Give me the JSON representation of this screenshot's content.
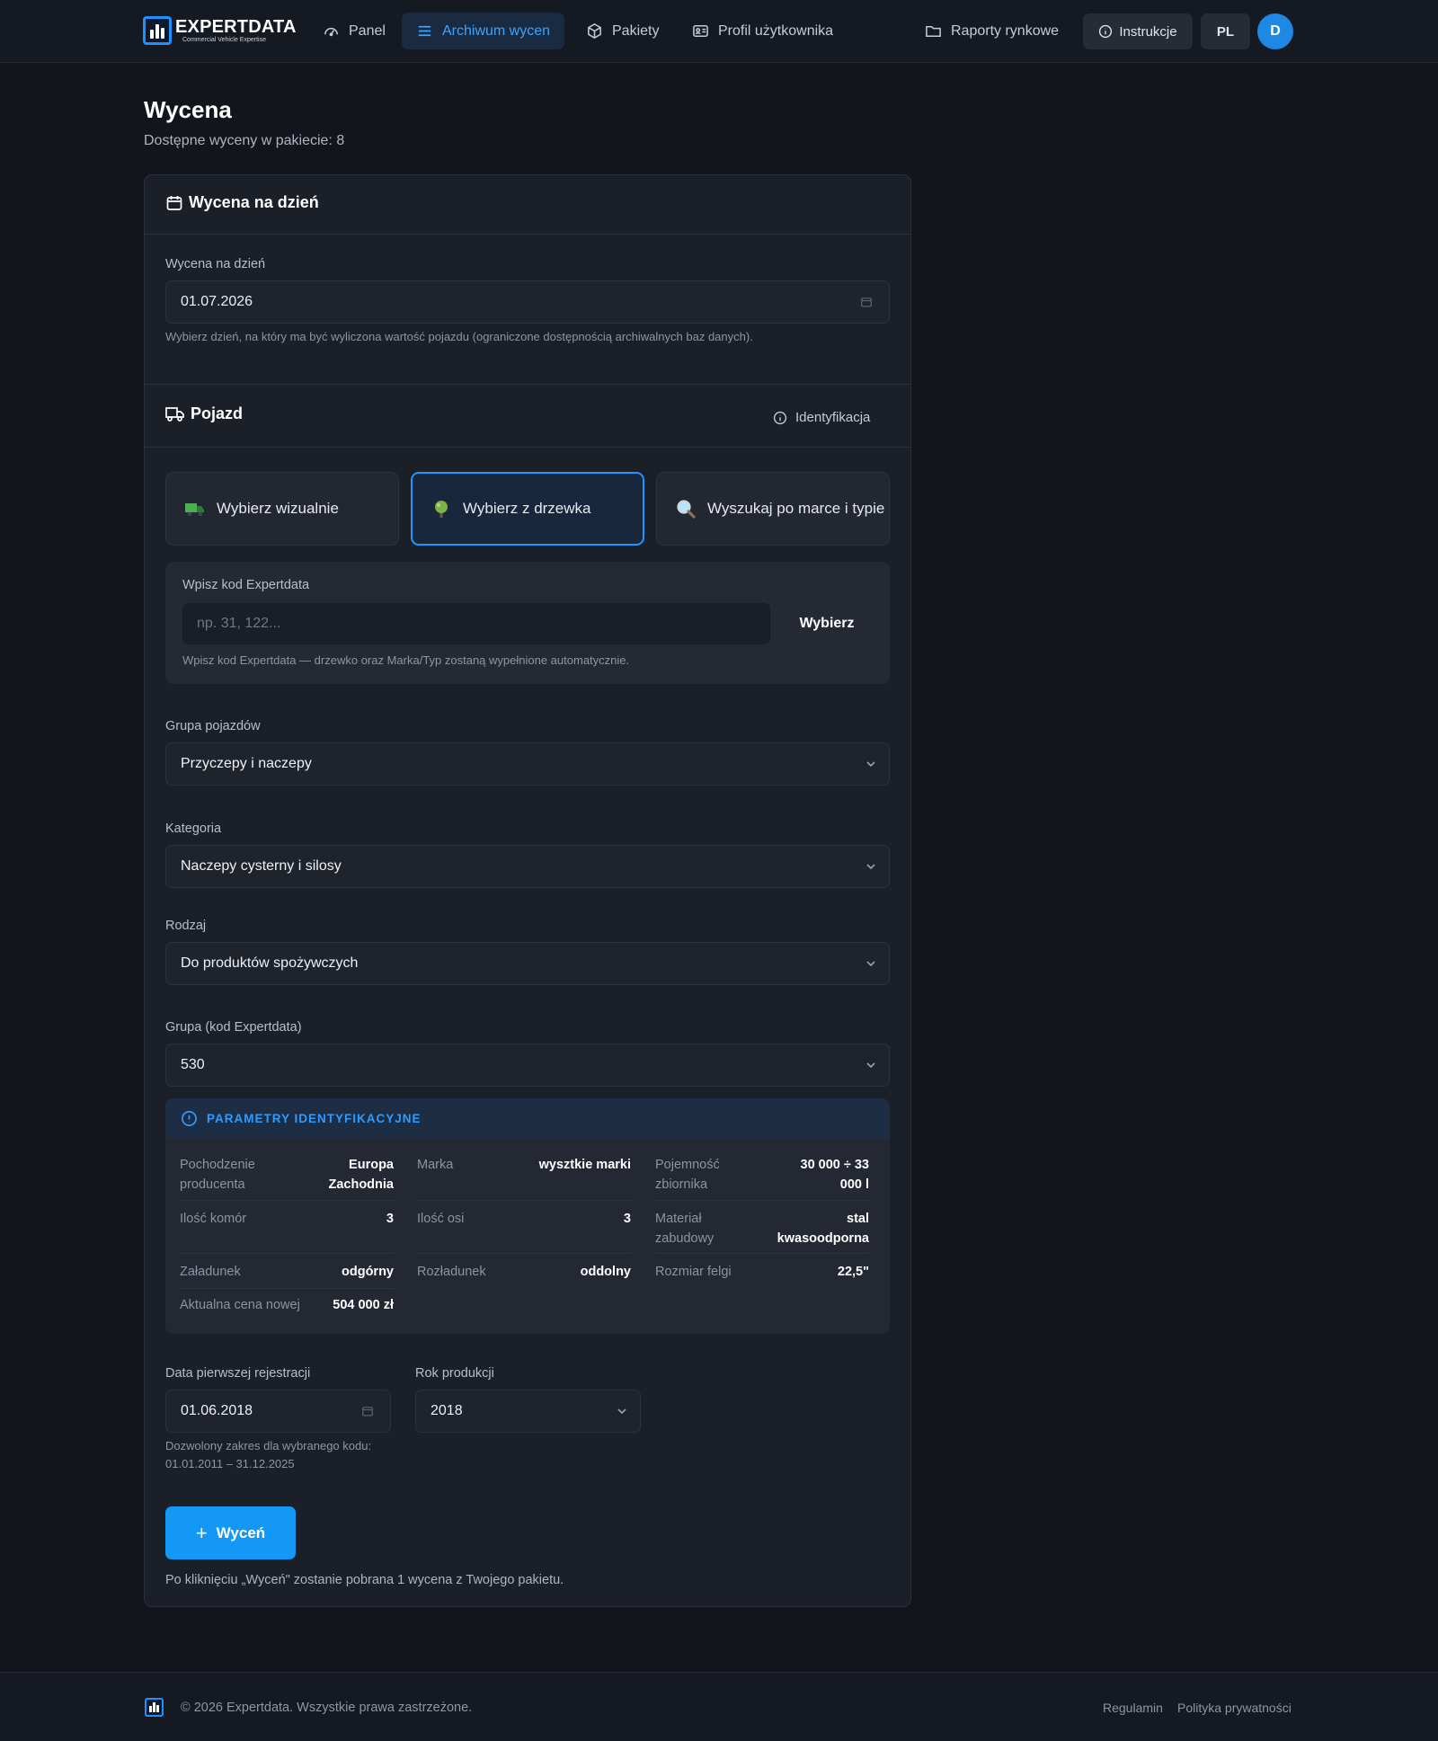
{
  "brand": {
    "title": "EXPERTDATA",
    "subtitle": "Commercial Vehicle Expertise",
    "accent": "#1e90ff"
  },
  "nav": {
    "items": [
      {
        "label": "Panel",
        "icon": "gauge-icon"
      },
      {
        "label": "Archiwum wycen",
        "icon": "list-icon",
        "active": true
      },
      {
        "label": "Pakiety",
        "icon": "package-icon"
      },
      {
        "label": "Profil użytkownika",
        "icon": "id-card-icon"
      }
    ],
    "reports": "Raporty rynkowe",
    "instructions": "Instrukcje",
    "lang": "PL",
    "avatar": "D"
  },
  "page": {
    "title": "Wycena",
    "subtitle": "Dostępne wyceny w pakiecie: 8"
  },
  "date_section": {
    "title": "Wycena na dzień",
    "label": "Wycena na dzień",
    "value": "01.07.2026",
    "hint": "Wybierz dzień, na który ma być wyliczona wartość pojazdu (ograniczone dostępnością archiwalnych baz danych)."
  },
  "vehicle_section": {
    "title": "Pojazd",
    "identification": "Identyfikacja",
    "options": [
      {
        "label": "Wybierz wizualnie",
        "icon": "truck-icon"
      },
      {
        "label": "Wybierz z drzewka",
        "icon": "tree-icon",
        "selected": true
      },
      {
        "label": "Wyszukaj po marce i typie",
        "icon": "magnifier-icon"
      }
    ],
    "code": {
      "label": "Wpisz kod Expertdata",
      "placeholder": "np. 31, 122...",
      "button": "Wybierz",
      "hint": "Wpisz kod Expertdata — drzewko oraz Marka/Typ zostaną wypełnione automatycznie."
    },
    "group": {
      "label": "Grupa pojazdów",
      "value": "Przyczepy i naczepy"
    },
    "category": {
      "label": "Kategoria",
      "value": "Naczepy cysterny i silosy"
    },
    "kind": {
      "label": "Rodzaj",
      "value": "Do produktów spożywczych"
    },
    "code_group": {
      "label": "Grupa (kod Expertdata)",
      "value": "530"
    }
  },
  "params": {
    "title": "PARAMETRY IDENTYFIKACYJNE",
    "rows": [
      [
        {
          "k": [
            "Pochodzenie",
            "producenta"
          ],
          "v": [
            "Europa",
            "Zachodnia"
          ]
        },
        {
          "k": [
            "Marka"
          ],
          "v": [
            "wysztkie marki"
          ]
        },
        {
          "k": [
            "Pojemność",
            "zbiornika"
          ],
          "v": [
            "30 000 ÷ 33",
            "000 l"
          ]
        }
      ],
      [
        {
          "k": [
            "Ilość komór"
          ],
          "v": [
            "3"
          ]
        },
        {
          "k": [
            "Ilość osi"
          ],
          "v": [
            "3"
          ]
        },
        {
          "k": [
            "Materiał",
            "zabudowy"
          ],
          "v": [
            "stal",
            "kwasoodporna"
          ]
        }
      ],
      [
        {
          "k": [
            "Załadunek"
          ],
          "v": [
            "odgórny"
          ]
        },
        {
          "k": [
            "Rozładunek"
          ],
          "v": [
            "oddolny"
          ]
        },
        {
          "k": [
            "Rozmiar felgi"
          ],
          "v": [
            "22,5\""
          ]
        }
      ],
      [
        {
          "k": [
            "Aktualna cena nowej"
          ],
          "v": [
            "504 000 zł"
          ]
        }
      ]
    ]
  },
  "registration": {
    "label": "Data pierwszej rejestracji",
    "value": "01.06.2018",
    "hint1": "Dozwolony zakres dla wybranego kodu:",
    "hint2": "01.01.2011 – 31.12.2025"
  },
  "production": {
    "label": "Rok produkcji",
    "value": "2018"
  },
  "action": {
    "button": "Wyceń",
    "note": "Po kliknięciu „Wyceń\" zostanie pobrana 1 wycena z Twojego pakietu."
  },
  "footer": {
    "copyright": "© 2026 Expertdata. Wszystkie prawa zastrzeżone.",
    "terms": "Regulamin",
    "privacy": "Polityka prywatności"
  }
}
